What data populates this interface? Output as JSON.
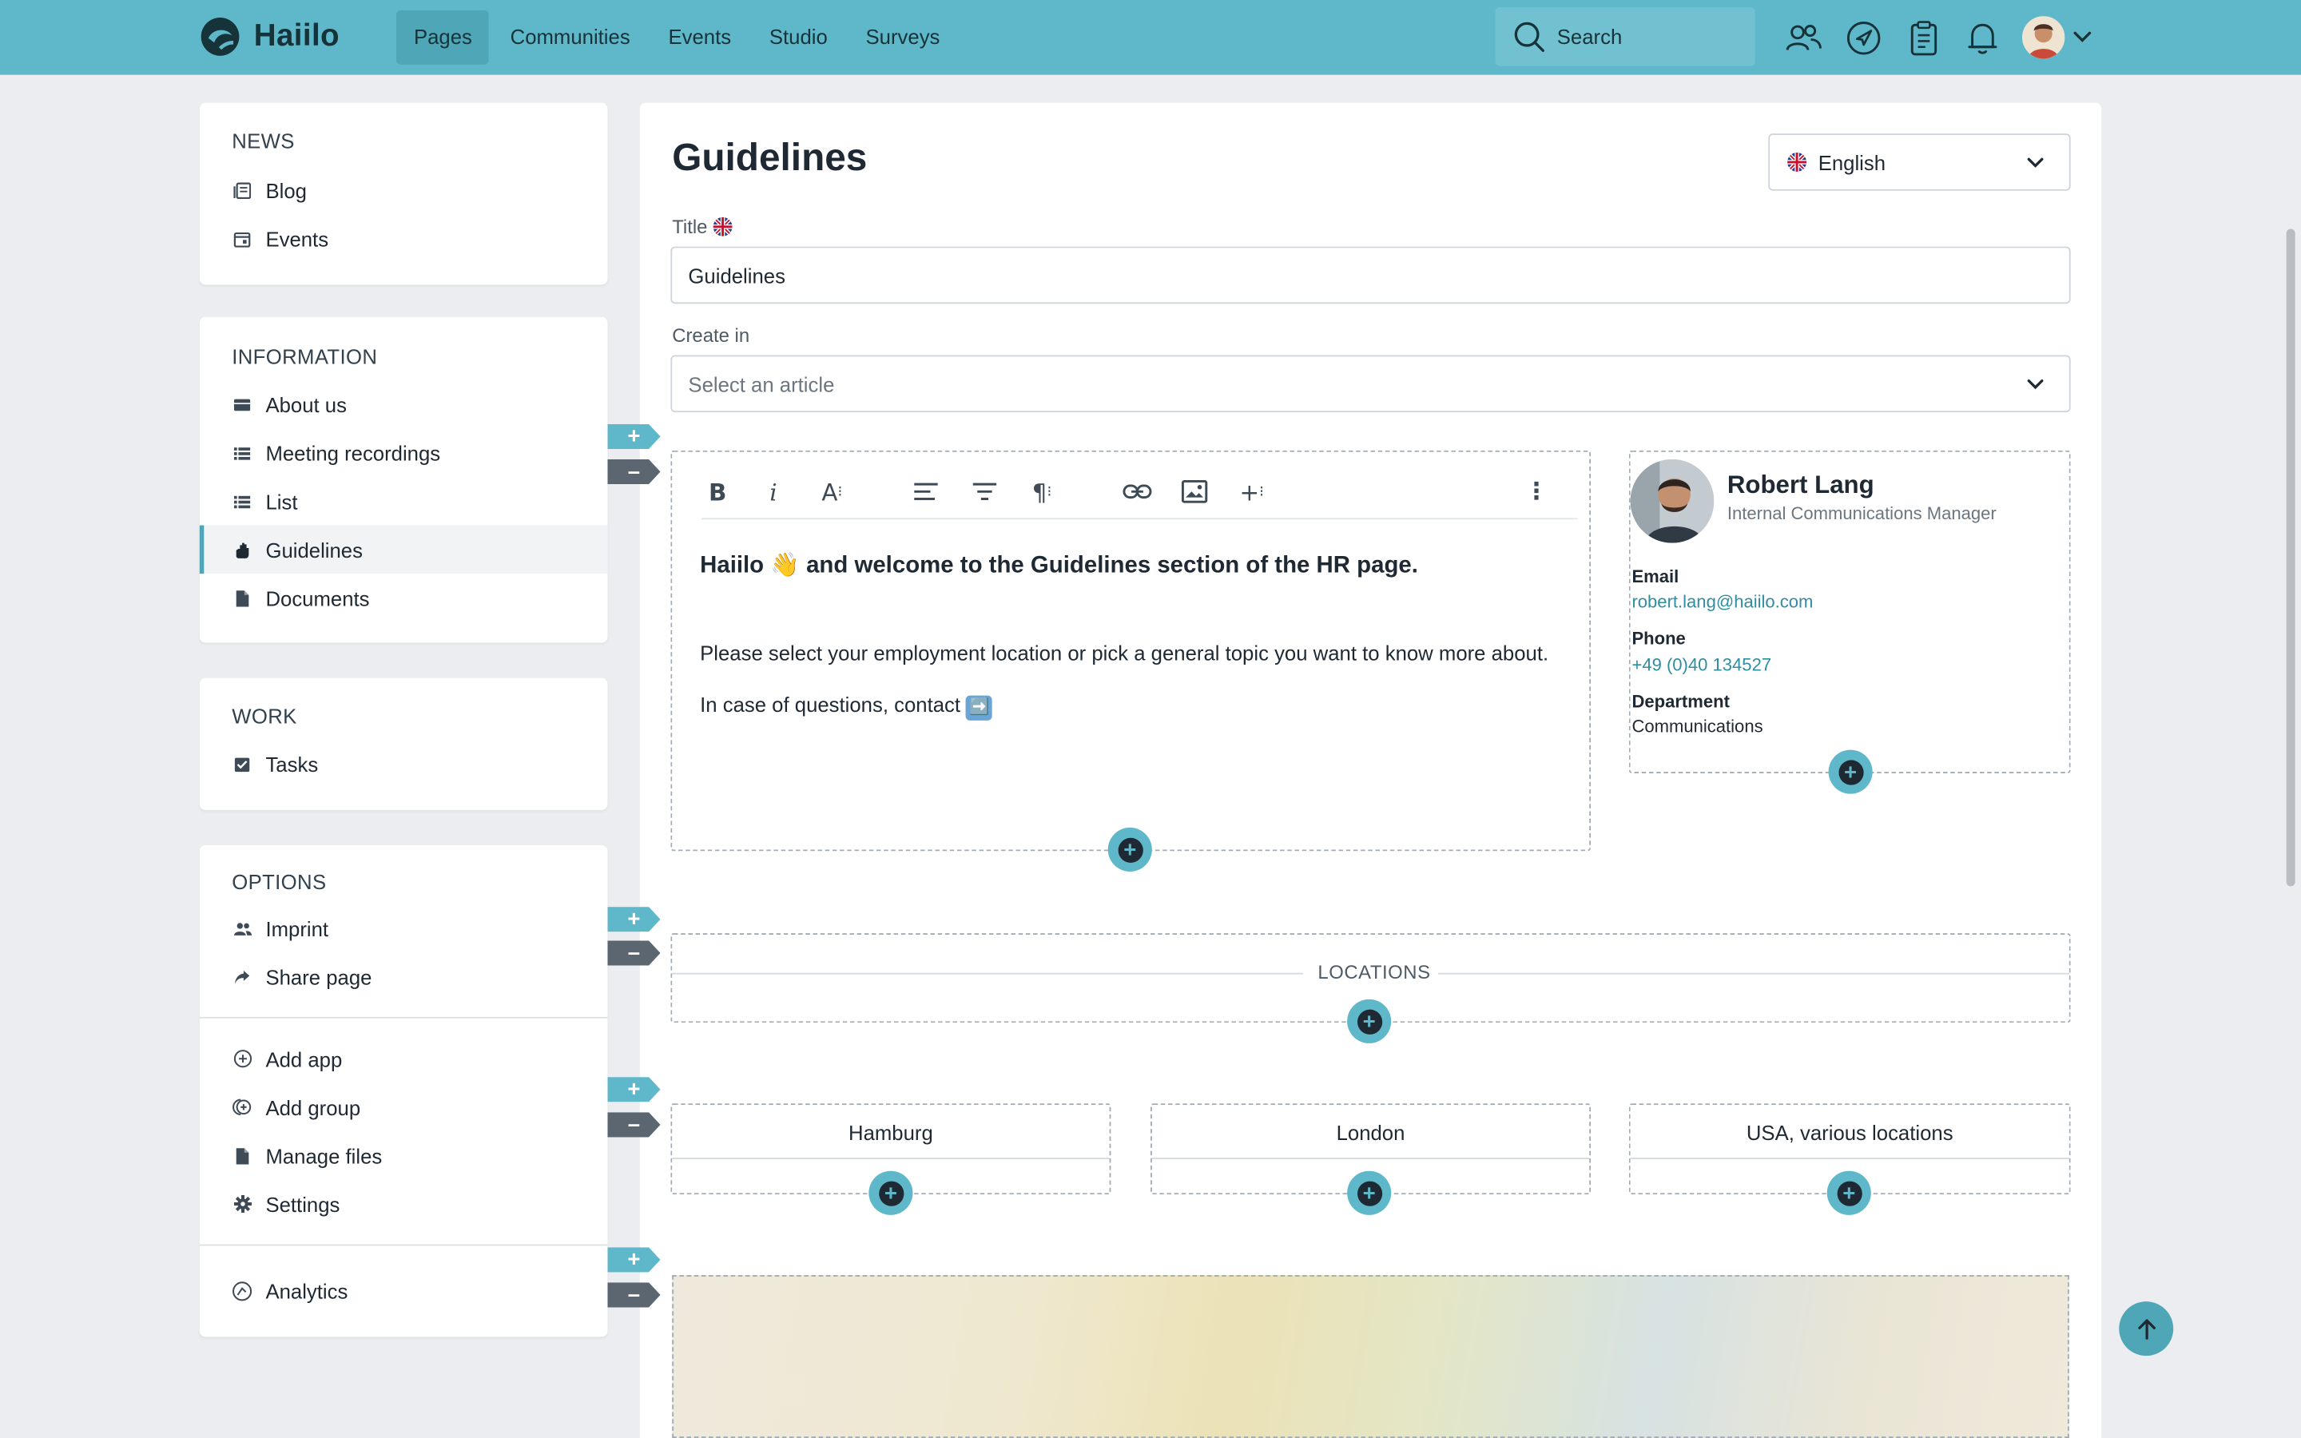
{
  "app": {
    "name": "Haiilo",
    "brand_color": "#5fb8c9"
  },
  "nav": {
    "items": [
      "Pages",
      "Communities",
      "Events",
      "Studio",
      "Surveys"
    ],
    "active": "Pages"
  },
  "search": {
    "placeholder": "Search"
  },
  "header_icons": [
    "people-icon",
    "compass-icon",
    "clipboard-icon",
    "bell-icon"
  ],
  "sidebar": {
    "news": {
      "title": "NEWS",
      "items": [
        {
          "label": "Blog",
          "icon": "blog-icon"
        },
        {
          "label": "Events",
          "icon": "calendar-icon"
        }
      ]
    },
    "information": {
      "title": "INFORMATION",
      "items": [
        {
          "label": "About us",
          "icon": "card-icon"
        },
        {
          "label": "Meeting recordings",
          "icon": "list-icon"
        },
        {
          "label": "List",
          "icon": "list-icon"
        },
        {
          "label": "Guidelines",
          "icon": "hand-icon",
          "active": true
        },
        {
          "label": "Documents",
          "icon": "document-icon"
        }
      ]
    },
    "work": {
      "title": "WORK",
      "items": [
        {
          "label": "Tasks",
          "icon": "checkbox-icon"
        }
      ]
    },
    "options": {
      "title": "OPTIONS",
      "items": [
        {
          "label": "Imprint",
          "icon": "people-icon"
        },
        {
          "label": "Share page",
          "icon": "share-icon"
        }
      ],
      "admin_items": [
        {
          "label": "Add app",
          "icon": "plus-circle-icon"
        },
        {
          "label": "Add group",
          "icon": "add-group-icon"
        },
        {
          "label": "Manage files",
          "icon": "file-icon"
        },
        {
          "label": "Settings",
          "icon": "gear-icon"
        }
      ],
      "analytics": {
        "label": "Analytics",
        "icon": "analytics-icon"
      }
    }
  },
  "page": {
    "title": "Guidelines",
    "language": "English",
    "title_field": {
      "label": "Title",
      "value": "Guidelines"
    },
    "create_in": {
      "label": "Create in",
      "placeholder": "Select an article"
    }
  },
  "editor": {
    "heading_pre": "Haiilo",
    "heading_emoji": "👋",
    "heading_mid": " and welcome to the ",
    "heading_bold": "Guidelines",
    "heading_post": " section of the HR page.",
    "paragraph1": "Please select your employment location or pick a general topic you want to know more about.",
    "paragraph2": "In case of questions, contact",
    "paragraph2_emoji": "➡️"
  },
  "contact": {
    "name": "Robert Lang",
    "role": "Internal Communications Manager",
    "email_label": "Email",
    "email": "robert.lang@haiilo.com",
    "phone_label": "Phone",
    "phone": "+49 (0)40 134527",
    "department_label": "Department",
    "department": "Communications"
  },
  "locations": {
    "title": "LOCATIONS",
    "items": [
      "Hamburg",
      "London",
      "USA, various locations"
    ]
  }
}
